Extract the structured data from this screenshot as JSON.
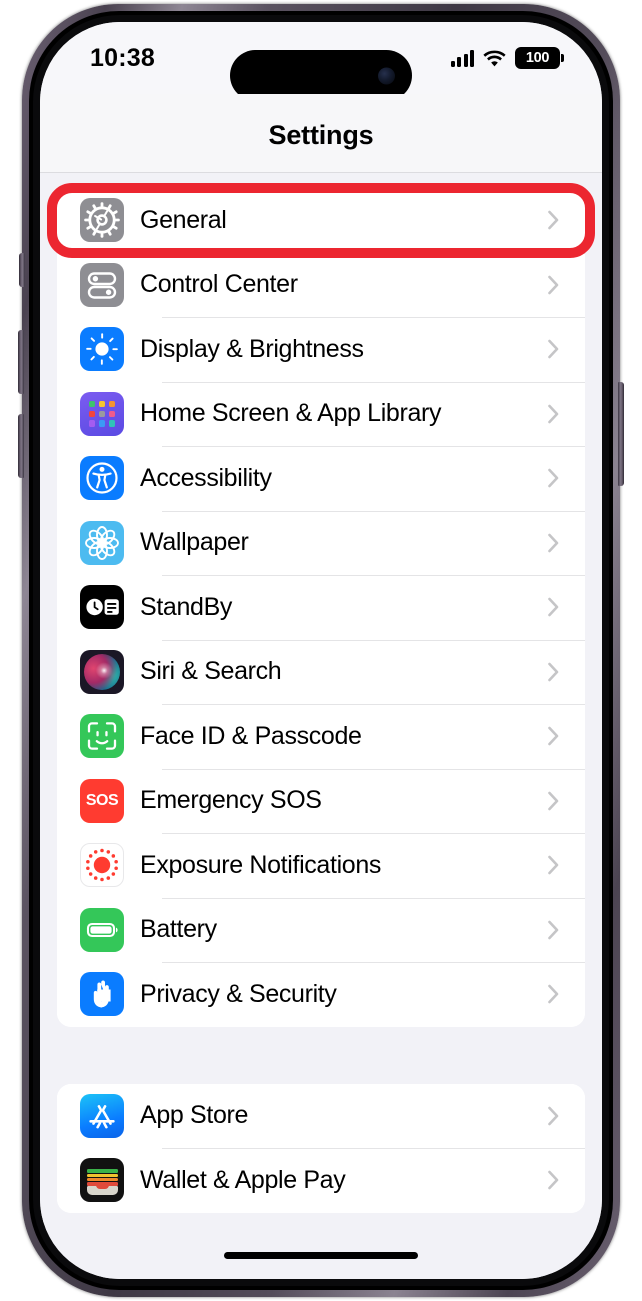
{
  "device": {
    "name": "iphone-15-pro"
  },
  "status_bar": {
    "time": "10:38",
    "cellular_icon": "cellular-bars-icon",
    "wifi_icon": "wifi-icon",
    "battery_percent": "100",
    "battery_icon": "battery-full-icon"
  },
  "nav": {
    "title": "Settings"
  },
  "annotation": {
    "type": "highlight-rectangle",
    "color": "#ec2630",
    "target": "General"
  },
  "groups": [
    {
      "id": "group-1",
      "rows": [
        {
          "label": "General",
          "icon": "gear-icon",
          "accessory": "chevron-right-icon",
          "highlighted": true
        },
        {
          "label": "Control Center",
          "icon": "sliders-toggles-icon",
          "accessory": "chevron-right-icon",
          "highlighted": false
        },
        {
          "label": "Display & Brightness",
          "icon": "brightness-sun-icon",
          "accessory": "chevron-right-icon",
          "highlighted": false
        },
        {
          "label": "Home Screen & App Library",
          "icon": "app-grid-icon",
          "accessory": "chevron-right-icon",
          "highlighted": false
        },
        {
          "label": "Accessibility",
          "icon": "accessibility-icon",
          "accessory": "chevron-right-icon",
          "highlighted": false
        },
        {
          "label": "Wallpaper",
          "icon": "wallpaper-flower-icon",
          "accessory": "chevron-right-icon",
          "highlighted": false
        },
        {
          "label": "StandBy",
          "icon": "standby-clock-widget-icon",
          "accessory": "chevron-right-icon",
          "highlighted": false
        },
        {
          "label": "Siri & Search",
          "icon": "siri-orb-icon",
          "accessory": "chevron-right-icon",
          "highlighted": false
        },
        {
          "label": "Face ID & Passcode",
          "icon": "face-id-icon",
          "accessory": "chevron-right-icon",
          "highlighted": false
        },
        {
          "label": "Emergency SOS",
          "icon": "sos-icon",
          "accessory": "chevron-right-icon",
          "highlighted": false
        },
        {
          "label": "Exposure Notifications",
          "icon": "exposure-notification-icon",
          "accessory": "chevron-right-icon",
          "highlighted": false
        },
        {
          "label": "Battery",
          "icon": "battery-icon",
          "accessory": "chevron-right-icon",
          "highlighted": false
        },
        {
          "label": "Privacy & Security",
          "icon": "privacy-hand-icon",
          "accessory": "chevron-right-icon",
          "highlighted": false
        }
      ]
    },
    {
      "id": "group-2",
      "rows": [
        {
          "label": "App Store",
          "icon": "app-store-icon",
          "accessory": "chevron-right-icon",
          "highlighted": false
        },
        {
          "label": "Wallet & Apple Pay",
          "icon": "wallet-icon",
          "accessory": "chevron-right-icon",
          "highlighted": false
        }
      ]
    }
  ],
  "home_indicator": {
    "name": "home-indicator"
  },
  "colors": {
    "background": "#f2f2f7",
    "card": "#ffffff",
    "separator": "#e4e4e6",
    "chevron": "#c5c5c7",
    "accent_red": "#ec2630"
  }
}
